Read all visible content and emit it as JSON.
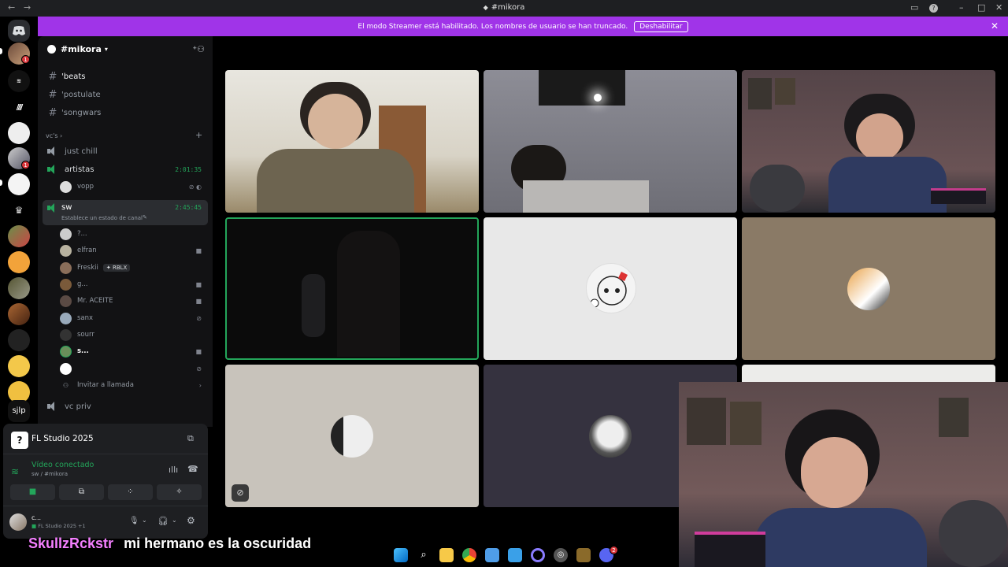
{
  "window": {
    "title": "#mikora"
  },
  "banner": {
    "message": "El modo Streamer está habilitado. Los nombres de usuario se han truncado.",
    "button": "Deshabilitar",
    "bg": "#a034e8"
  },
  "server_rail": {
    "badges": [
      "1",
      "1"
    ],
    "last_label": "sjlp"
  },
  "sidebar": {
    "server_name": "#mikora",
    "channels": [
      {
        "name": "'beats"
      },
      {
        "name": "'postulate"
      },
      {
        "name": "'songwars"
      }
    ],
    "category": "vc's",
    "voice": {
      "just_chill": "just chill",
      "artistas": {
        "name": "artistas",
        "timer": "2:01:35",
        "users": [
          "vopp"
        ]
      },
      "sw": {
        "name": "sw",
        "timer": "2:45:45",
        "status": "Establece un estado de canal",
        "users": [
          {
            "name": "?..."
          },
          {
            "name": "elfran"
          },
          {
            "name": "Freskii",
            "tag": "RBLX"
          },
          {
            "name": "g..."
          },
          {
            "name": "Mr. ACEITE"
          },
          {
            "name": "sanx"
          },
          {
            "name": "sourr"
          },
          {
            "name": "s..."
          },
          {
            "name": ""
          }
        ],
        "invite": "Invitar a llamada"
      },
      "vc_priv": "vc priv"
    }
  },
  "panel": {
    "activity": "FL Studio 2025",
    "connection": "Vídeo conectado",
    "channel_path": "sw / #mikora",
    "user_name": "c...",
    "user_activity": "FL Studio 2025 +1",
    "accent": "#23a55a"
  },
  "subtitle": {
    "user": "SkullzRckstr",
    "message": "mi hermano es la oscuridad",
    "user_color": "#f47fff"
  },
  "taskbar": {
    "discord_badge": "2"
  }
}
